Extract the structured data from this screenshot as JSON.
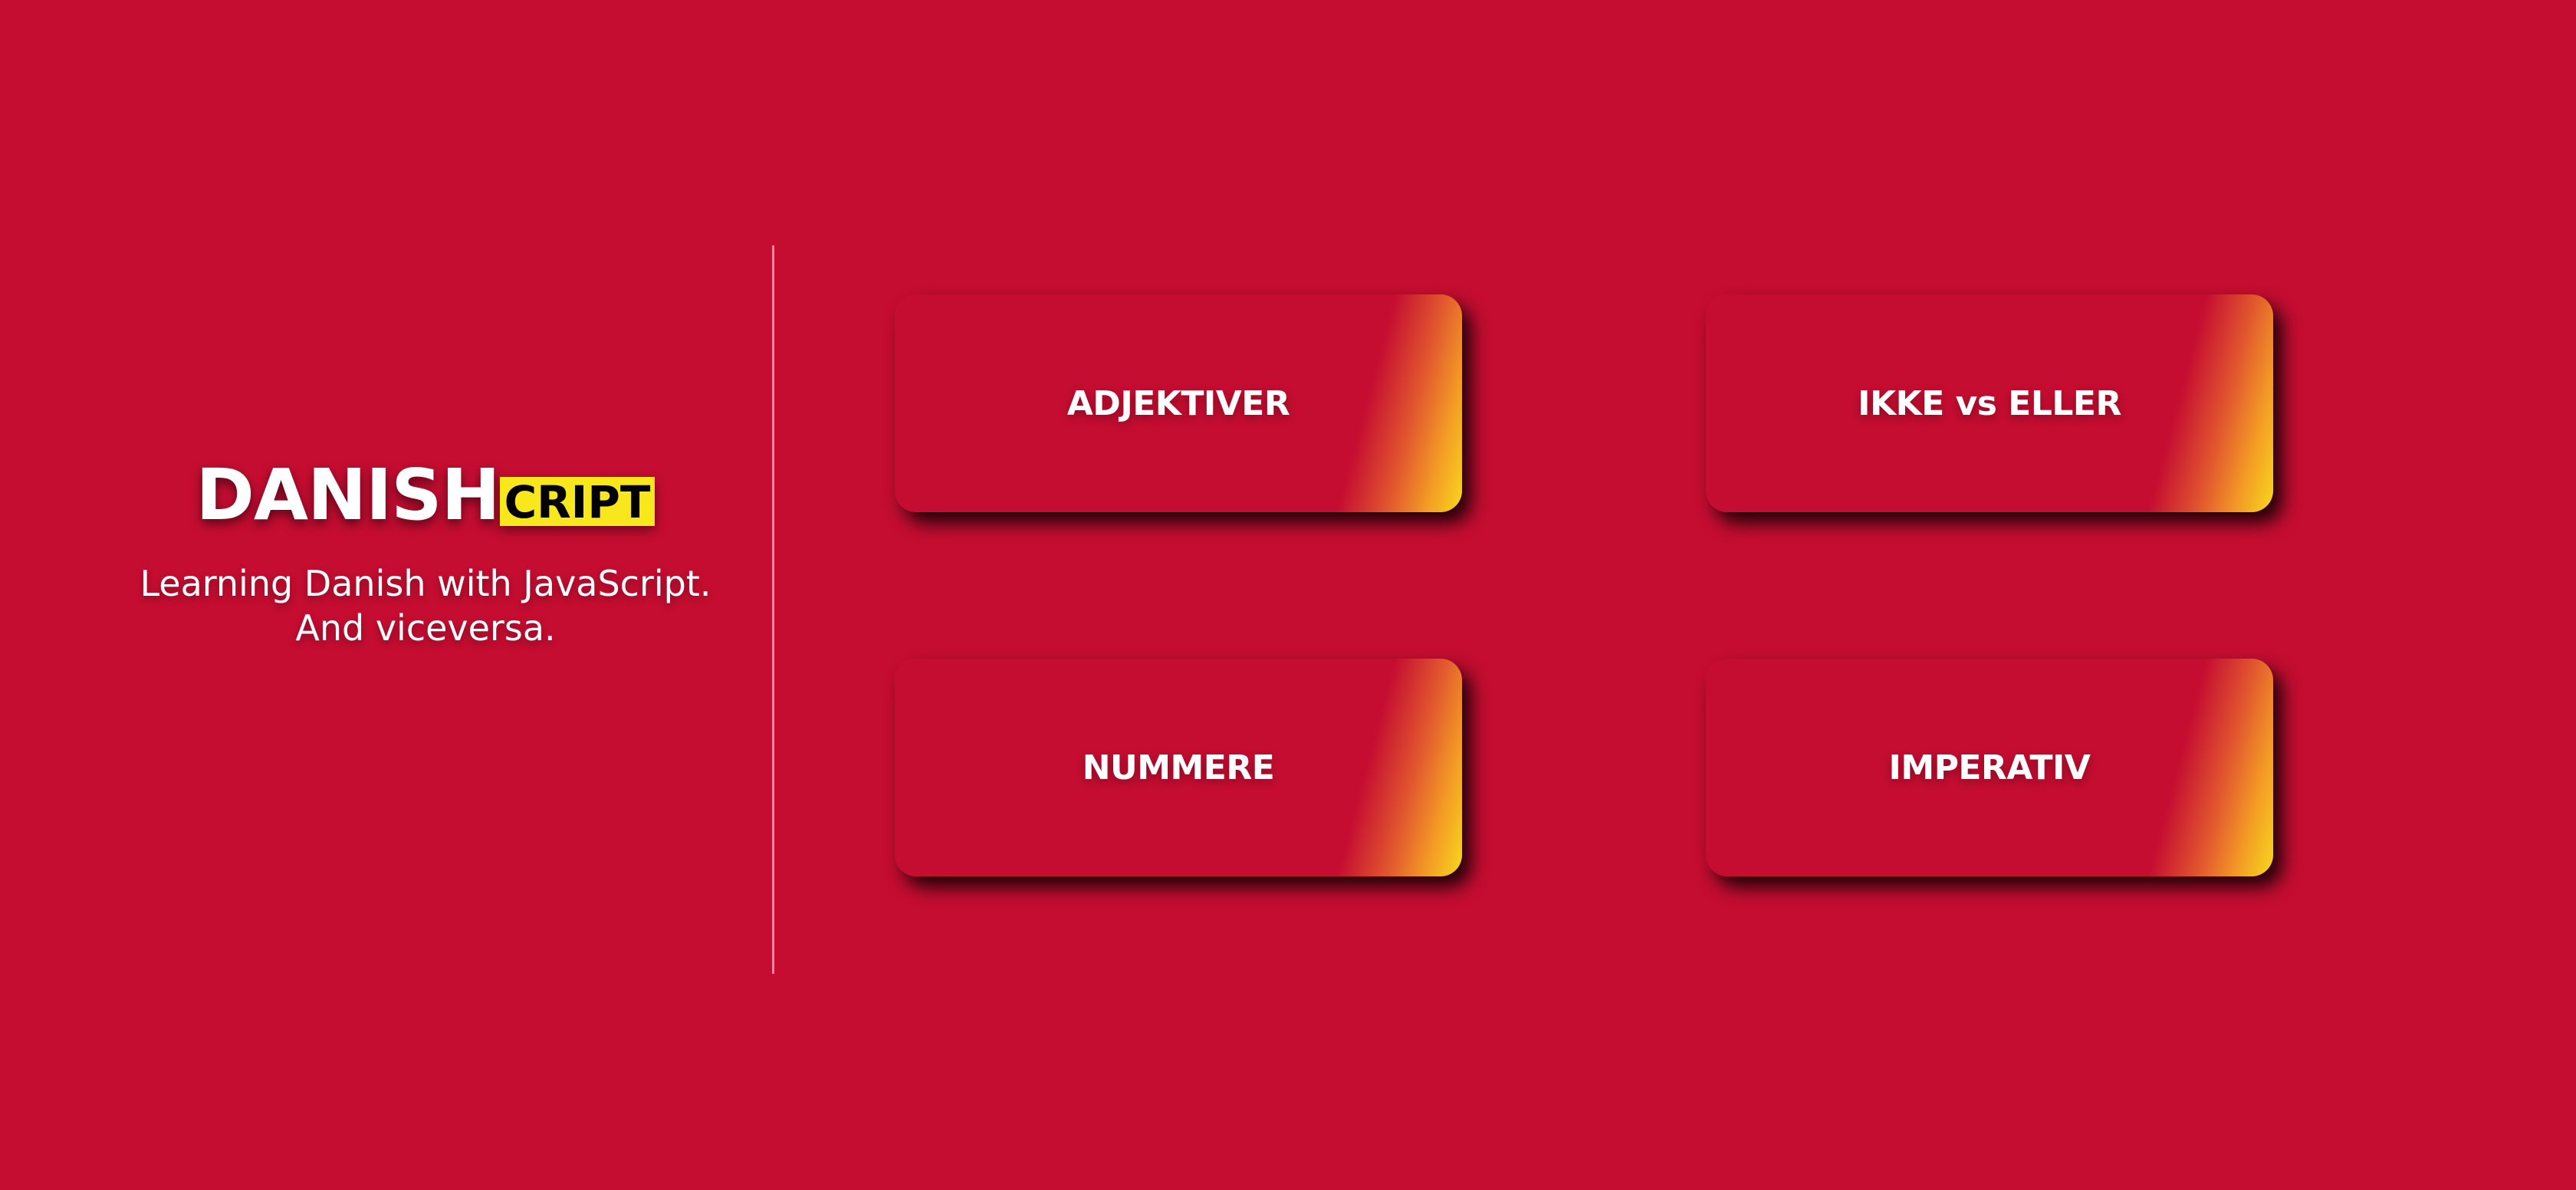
{
  "brand": {
    "logo_main": "DANISH",
    "logo_suffix": "CRIPT",
    "tagline_line1": "Learning Danish with JavaScript.",
    "tagline_line2": "And viceversa."
  },
  "topics": [
    {
      "label": "ADJEKTIVER"
    },
    {
      "label": "IKKE vs ELLER"
    },
    {
      "label": "NUMMERE"
    },
    {
      "label": "IMPERATIV"
    }
  ],
  "colors": {
    "background": "#c50d31",
    "accent_yellow": "#f8e71c",
    "accent_orange": "#f39a25",
    "text": "#ffffff"
  }
}
